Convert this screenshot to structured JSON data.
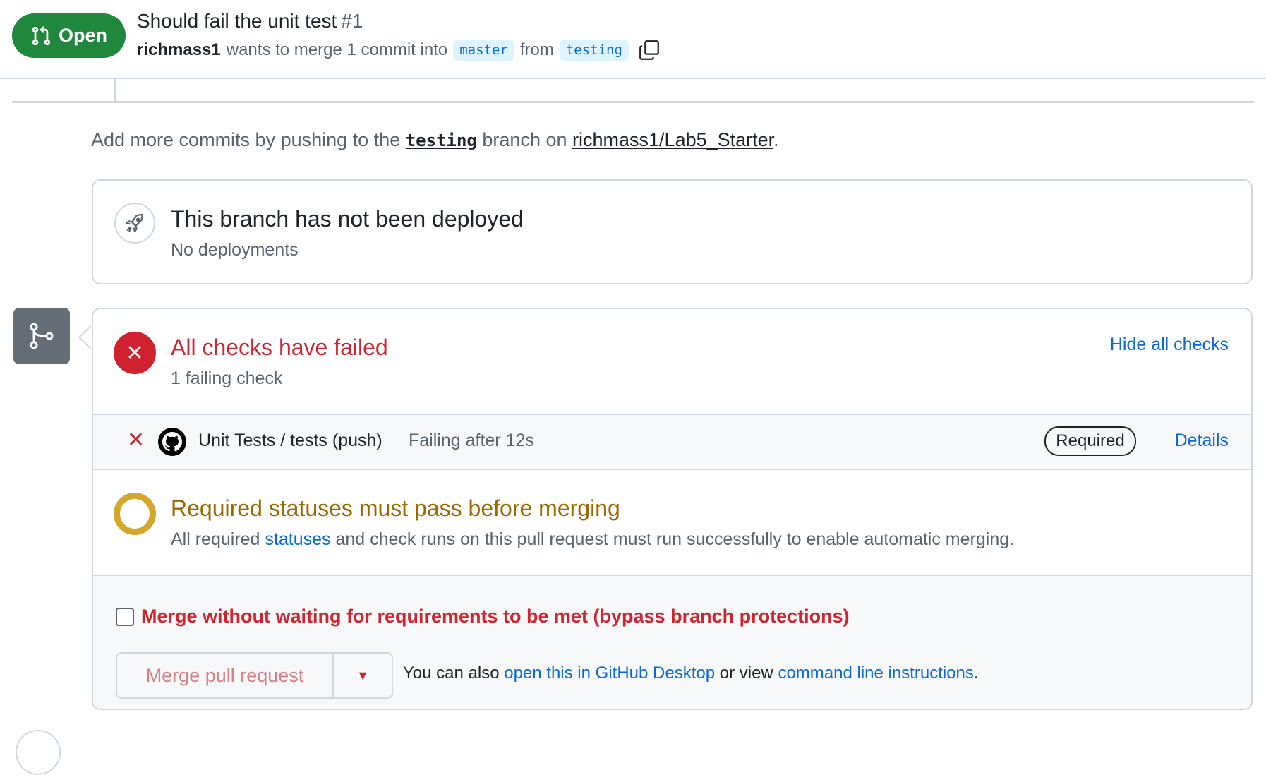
{
  "header": {
    "state": "Open",
    "title": "Should fail the unit test",
    "number": "#1",
    "author": "richmass1",
    "wants_text": "wants to merge 1 commit into",
    "base_branch": "master",
    "from_text": "from",
    "head_branch": "testing"
  },
  "push_hint": {
    "prefix": "Add more commits by pushing to the",
    "branch": "testing",
    "middle": "branch on",
    "repo": "richmass1/Lab5_Starter",
    "suffix": "."
  },
  "deployment": {
    "title": "This branch has not been deployed",
    "subtitle": "No deployments"
  },
  "checks": {
    "title": "All checks have failed",
    "subtitle": "1 failing check",
    "hide_link": "Hide all checks",
    "items": [
      {
        "name": "Unit Tests / tests (push)",
        "status": "Failing after 12s",
        "badge": "Required",
        "details": "Details"
      }
    ]
  },
  "required_status": {
    "title": "Required statuses must pass before merging",
    "desc_prefix": "All required",
    "desc_link": "statuses",
    "desc_suffix": "and check runs on this pull request must run successfully to enable automatic merging."
  },
  "merge": {
    "bypass_label": "Merge without waiting for requirements to be met (bypass branch protections)",
    "button_label": "Merge pull request",
    "also_prefix": "You can also",
    "desktop_link": "open this in GitHub Desktop",
    "or_text": "or view",
    "cli_link": "command line instructions",
    "end": "."
  },
  "colors": {
    "open_green": "#1f883d",
    "fail_red": "#cf222e",
    "pending_yellow": "#d4a72c",
    "link_blue": "#0969da"
  }
}
